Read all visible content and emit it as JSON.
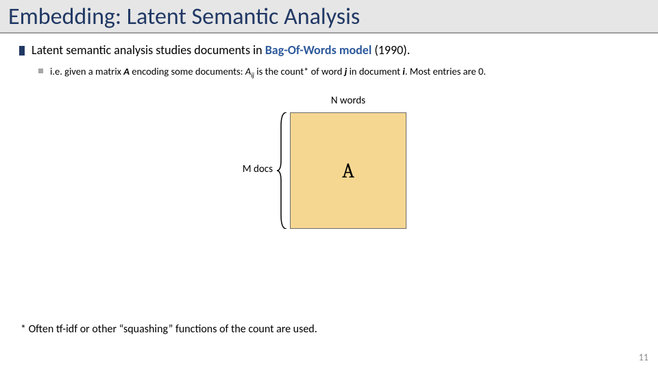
{
  "title": "Embedding: Latent Semantic Analysis",
  "bullet1": {
    "pre": "Latent semantic analysis studies documents in ",
    "highlight": "Bag-Of-Words model",
    "post": " (1990)."
  },
  "sub": {
    "pre": "i.e. given a matrix ",
    "A": "A",
    "mid1": " encoding some documents: ",
    "Aij_A": "A",
    "Aij_ij": "ij",
    "mid2": " is the count* of word ",
    "j": "j",
    "mid3": " in document ",
    "i": "i",
    "post": ". Most entries are 0."
  },
  "diagram": {
    "n_words": "N words",
    "m_docs": "M docs",
    "matrix_label": "A"
  },
  "footnote": "* Often tf-idf or other “squashing” functions of the count are used.",
  "page_number": "11"
}
